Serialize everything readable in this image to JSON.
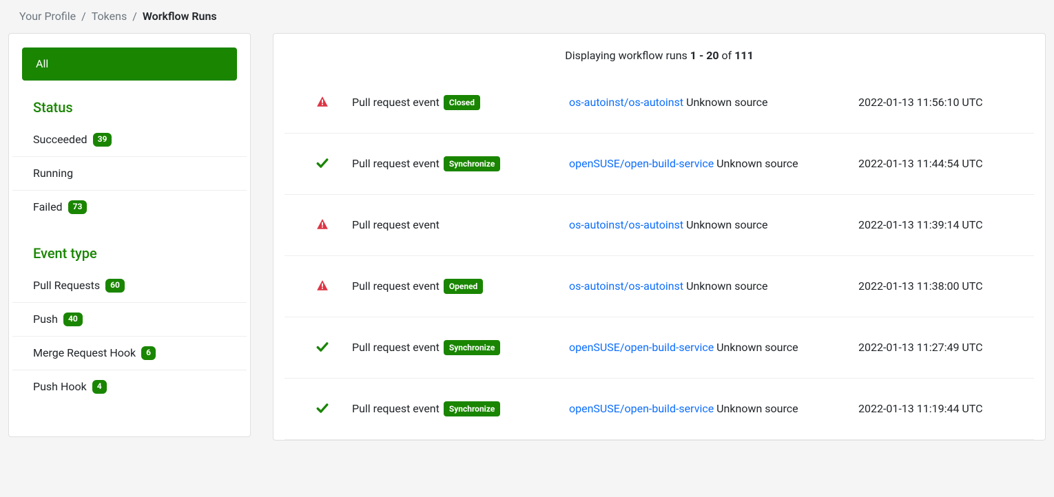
{
  "breadcrumb": {
    "profile": "Your Profile",
    "tokens": "Tokens",
    "current": "Workflow Runs"
  },
  "sidebar": {
    "all": "All",
    "status": {
      "heading": "Status",
      "items": [
        {
          "label": "Succeeded",
          "count": "39"
        },
        {
          "label": "Running",
          "count": null
        },
        {
          "label": "Failed",
          "count": "73"
        }
      ]
    },
    "event_type": {
      "heading": "Event type",
      "items": [
        {
          "label": "Pull Requests",
          "count": "60"
        },
        {
          "label": "Push",
          "count": "40"
        },
        {
          "label": "Merge Request Hook",
          "count": "6"
        },
        {
          "label": "Push Hook",
          "count": "4"
        }
      ]
    }
  },
  "header": {
    "displaying_prefix": "Displaying workflow runs ",
    "range": "1 - 20",
    "of": " of ",
    "total": "111"
  },
  "runs": [
    {
      "status": "fail",
      "event": "Pull request event",
      "tag": "Closed",
      "repo": "os-autoinst/os-autoinst",
      "after": " Unknown source",
      "timestamp": "2022-01-13 11:56:10 UTC"
    },
    {
      "status": "ok",
      "event": "Pull request event",
      "tag": "Synchronize",
      "repo": "openSUSE/open-build-service",
      "after": " Unknown source",
      "timestamp": "2022-01-13 11:44:54 UTC"
    },
    {
      "status": "fail",
      "event": "Pull request event",
      "tag": null,
      "repo": "os-autoinst/os-autoinst",
      "after": " Unknown source",
      "timestamp": "2022-01-13 11:39:14 UTC"
    },
    {
      "status": "fail",
      "event": "Pull request event",
      "tag": "Opened",
      "repo": "os-autoinst/os-autoinst",
      "after": " Unknown source",
      "timestamp": "2022-01-13 11:38:00 UTC"
    },
    {
      "status": "ok",
      "event": "Pull request event",
      "tag": "Synchronize",
      "repo": "openSUSE/open-build-service",
      "after": " Unknown source",
      "timestamp": "2022-01-13 11:27:49 UTC"
    },
    {
      "status": "ok",
      "event": "Pull request event",
      "tag": "Synchronize",
      "repo": "openSUSE/open-build-service",
      "after": " Unknown source",
      "timestamp": "2022-01-13 11:19:44 UTC"
    }
  ]
}
